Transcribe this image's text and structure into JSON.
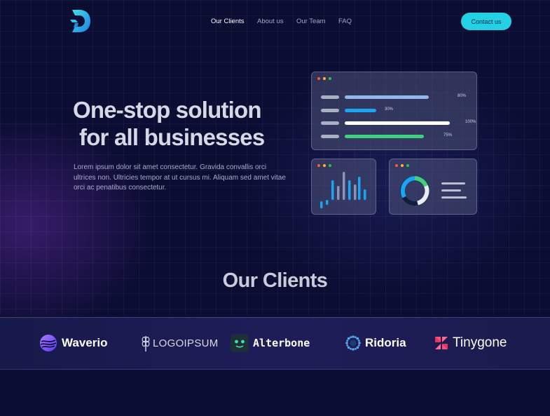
{
  "nav": {
    "items": [
      {
        "label": "Our Clients",
        "active": true
      },
      {
        "label": "About us",
        "active": false
      },
      {
        "label": "Our Team",
        "active": false
      },
      {
        "label": "FAQ",
        "active": false
      }
    ],
    "cta_label": "Contact us"
  },
  "hero": {
    "title_line1": "One-stop solution",
    "title_line2": "for all businesses",
    "description": "Lorem ipsum dolor sit amet consectetur. Gravida convallis orci ultrices non. Ultricies tempor at ut cursus mi. Aliquam sed amet vitae orci ac penatibus consectetur."
  },
  "progress_card": {
    "bars": [
      {
        "percent_label": "80%",
        "value": 0.8,
        "color": "#8fb8e8"
      },
      {
        "percent_label": "30%",
        "value": 0.3,
        "color": "#1aa6f0"
      },
      {
        "percent_label": "100%",
        "value": 1.0,
        "color": "#ffffff"
      },
      {
        "percent_label": "75%",
        "value": 0.75,
        "color": "#3fcf7f"
      }
    ]
  },
  "colors": {
    "accent": "#24d0e4",
    "background": "#0b0d33",
    "bar_blue": "#1aa6f0",
    "bar_gray": "#8a95b5"
  },
  "clients": {
    "title": "Our Clients",
    "logos": [
      {
        "name": "Waverio",
        "icon": "waverio-logo-icon"
      },
      {
        "name": "LOGOIPSUM",
        "icon": "logoipsum-wheat-icon"
      },
      {
        "name": "Alterbone",
        "icon": "alterbone-face-icon"
      },
      {
        "name": "Ridoria",
        "icon": "ridoria-burst-icon"
      },
      {
        "name": "Tinygone",
        "icon": "tinygone-flower-icon"
      }
    ]
  }
}
